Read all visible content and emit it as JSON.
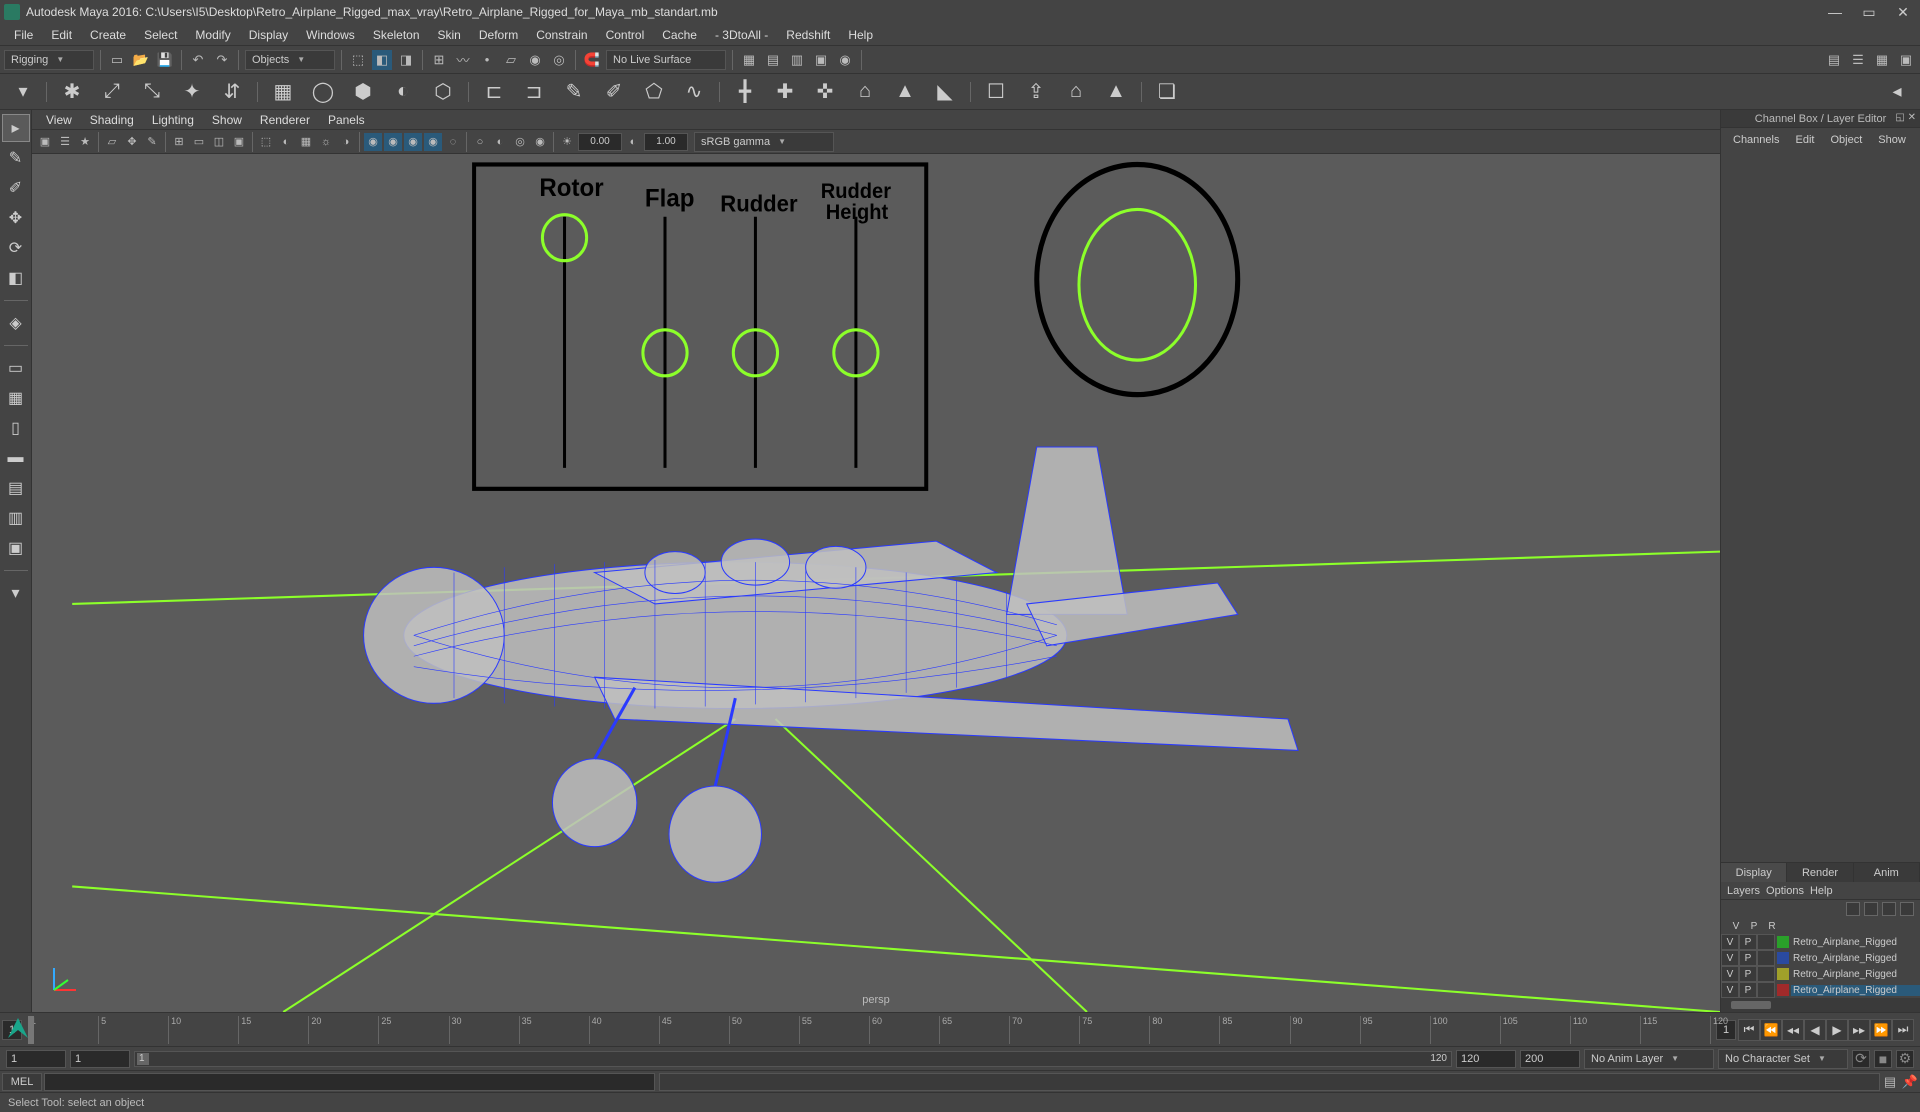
{
  "app": {
    "title": "Autodesk Maya 2016: C:\\Users\\I5\\Desktop\\Retro_Airplane_Rigged_max_vray\\Retro_Airplane_Rigged_for_Maya_mb_standart.mb"
  },
  "win": {
    "min": "—",
    "max": "▭",
    "close": "✕"
  },
  "menu": [
    "File",
    "Edit",
    "Create",
    "Select",
    "Modify",
    "Display",
    "Windows",
    "Skeleton",
    "Skin",
    "Deform",
    "Constrain",
    "Control",
    "Cache",
    "- 3DtoAll -",
    "Redshift",
    "Help"
  ],
  "shelf": {
    "menuset": "Rigging",
    "selmode": "Objects",
    "nolive": "No Live Surface"
  },
  "viewmenu": [
    "View",
    "Shading",
    "Lighting",
    "Show",
    "Renderer",
    "Panels"
  ],
  "viewtool": {
    "num1": "0.00",
    "num2": "1.00",
    "colorspace": "sRGB gamma"
  },
  "camera": "persp",
  "rig_labels": {
    "rotor": "Rotor",
    "flap": "Flap",
    "rudder": "Rudder",
    "rudderheight": "Rudder Height"
  },
  "right": {
    "title": "Channel Box / Layer Editor",
    "tabs": [
      "Channels",
      "Edit",
      "Object",
      "Show"
    ],
    "layertabs": {
      "display": "Display",
      "render": "Render",
      "anim": "Anim"
    },
    "layermenu": [
      "Layers",
      "Options",
      "Help"
    ],
    "layerhdr": {
      "v": "V",
      "p": "P",
      "r": "R"
    },
    "layers": [
      {
        "v": "V",
        "p": "P",
        "r": "",
        "color": "#2aa02a",
        "name": "Retro_Airplane_Rigged",
        "sel": false
      },
      {
        "v": "V",
        "p": "P",
        "r": "",
        "color": "#2a4aa0",
        "name": "Retro_Airplane_Rigged",
        "sel": false
      },
      {
        "v": "V",
        "p": "P",
        "r": "",
        "color": "#a0a02a",
        "name": "Retro_Airplane_Rigged",
        "sel": false
      },
      {
        "v": "V",
        "p": "P",
        "r": "",
        "color": "#a02a2a",
        "name": "Retro_Airplane_Rigged",
        "sel": true
      }
    ]
  },
  "timeline": {
    "start": "1",
    "end": "120",
    "curframe": "1",
    "curframe2": "1",
    "ticks": [
      "1",
      "5",
      "10",
      "15",
      "20",
      "25",
      "30",
      "35",
      "40",
      "45",
      "50",
      "55",
      "60",
      "65",
      "70",
      "75",
      "80",
      "85",
      "90",
      "95",
      "100",
      "105",
      "110",
      "115",
      "120"
    ]
  },
  "range": {
    "start": "1",
    "end": "120",
    "rstart": "1",
    "rend": "120",
    "in": "120",
    "out": "200",
    "animlayer": "No Anim Layer",
    "charset": "No Character Set"
  },
  "cmd": {
    "lang": "MEL"
  },
  "help": "Select Tool: select an object"
}
